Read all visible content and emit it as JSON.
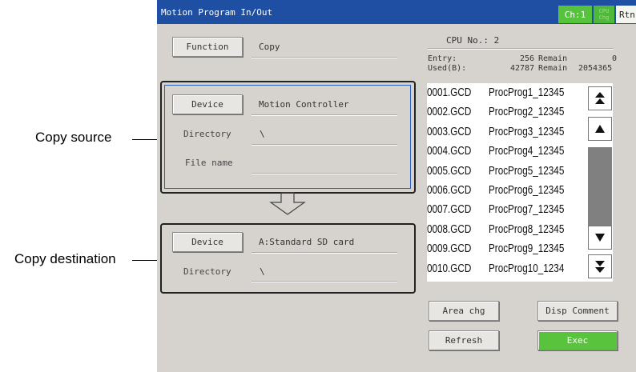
{
  "window": {
    "title": "Motion Program In/Out",
    "ch_label": "Ch:1",
    "cpu_label": "CPU Chg",
    "rtn_label": "Rtn"
  },
  "function": {
    "button_label": "Function",
    "value": "Copy"
  },
  "cpu": {
    "label": "CPU No.: 2"
  },
  "stats": {
    "entry_label": "Entry:",
    "entry_value": "256",
    "entry_remain_label": "Remain",
    "entry_remain_value": "0",
    "used_label": "Used(B):",
    "used_value": "42787",
    "used_remain_label": "Remain",
    "used_remain_value": "2054365"
  },
  "source": {
    "device_button_label": "Device",
    "device_value": "Motion Controller",
    "directory_label": "Directory",
    "directory_value": "\\",
    "filename_label": "File name",
    "filename_value": ""
  },
  "destination": {
    "device_button_label": "Device",
    "device_value": "A:Standard SD card",
    "directory_label": "Directory",
    "directory_value": "\\"
  },
  "files": [
    {
      "file": "0001.GCD",
      "name": "ProcProg1_12345"
    },
    {
      "file": "0002.GCD",
      "name": "ProcProg2_12345"
    },
    {
      "file": "0003.GCD",
      "name": "ProcProg3_12345"
    },
    {
      "file": "0004.GCD",
      "name": "ProcProg4_12345"
    },
    {
      "file": "0005.GCD",
      "name": "ProcProg5_12345"
    },
    {
      "file": "0006.GCD",
      "name": "ProcProg6_12345"
    },
    {
      "file": "0007.GCD",
      "name": "ProcProg7_12345"
    },
    {
      "file": "0008.GCD",
      "name": "ProcProg8_12345"
    },
    {
      "file": "0009.GCD",
      "name": "ProcProg9_12345"
    },
    {
      "file": "0010.GCD",
      "name": "ProcProg10_1234"
    }
  ],
  "buttons": {
    "area_chg": "Area chg",
    "disp_comment": "Disp Comment",
    "refresh": "Refresh",
    "exec": "Exec"
  },
  "callouts": {
    "source": "Copy source",
    "destination": "Copy destination"
  },
  "icons": {
    "scroll_top": "double-up-arrow-icon",
    "scroll_up": "up-arrow-icon",
    "scroll_down": "down-arrow-icon",
    "scroll_bottom": "double-down-arrow-icon",
    "flow": "down-arrow-outline-icon"
  },
  "colors": {
    "titlebar": "#1f4fa3",
    "accent_green": "#59c33e",
    "panel": "#d6d3ce"
  }
}
